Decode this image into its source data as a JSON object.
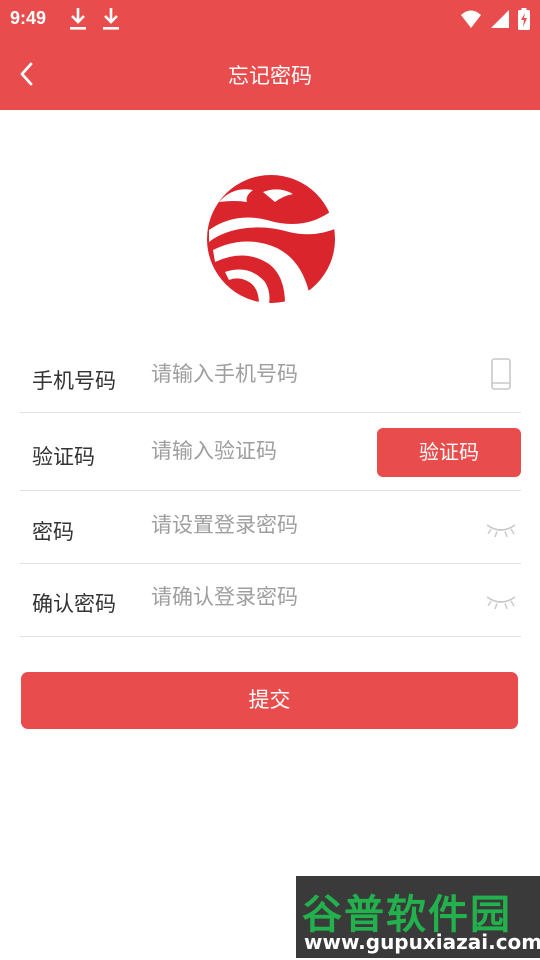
{
  "status_bar": {
    "time": "9:49",
    "icons": [
      "download-icon",
      "download-icon",
      "wifi-icon",
      "signal-icon",
      "battery-charging-icon"
    ]
  },
  "navbar": {
    "title": "忘记密码",
    "back_icon": "chevron-left-icon"
  },
  "logo": {
    "icon": "dragon-logo-icon",
    "color": "#d9252b"
  },
  "form": {
    "phone": {
      "label": "手机号码",
      "placeholder": "请输入手机号码",
      "icon": "phone-icon"
    },
    "code": {
      "label": "验证码",
      "placeholder": "请输入验证码",
      "button": "验证码"
    },
    "password": {
      "label": "密码",
      "placeholder": "请设置登录密码",
      "icon": "eye-closed-icon"
    },
    "confirm": {
      "label": "确认密码",
      "placeholder": "请确认登录密码",
      "icon": "eye-closed-icon"
    }
  },
  "submit_label": "提交",
  "watermark": {
    "title": "谷普软件园",
    "url": "www.gupuxiazai.com"
  },
  "colors": {
    "accent": "#e84c4c",
    "placeholder": "#9e9e9e",
    "divider": "#e0e0e0",
    "watermark_green": "#22b14c"
  }
}
